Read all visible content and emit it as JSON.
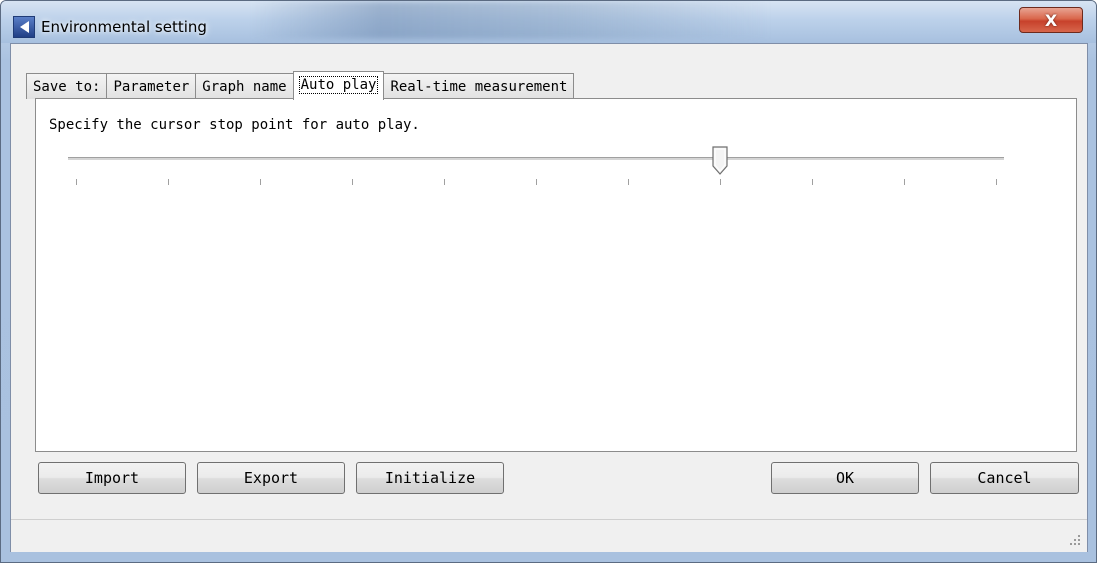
{
  "window": {
    "title": "Environmental setting",
    "close_label": "X"
  },
  "tabs": [
    {
      "label": "Save to:",
      "active": false
    },
    {
      "label": "Parameter",
      "active": false
    },
    {
      "label": "Graph name",
      "active": false
    },
    {
      "label": "Auto play",
      "active": true
    },
    {
      "label": "Real-time measurement",
      "active": false
    }
  ],
  "auto_play": {
    "instruction": "Specify the cursor stop point for auto play.",
    "slider": {
      "min": 0,
      "max": 10,
      "value": 7,
      "tick_count": 11
    }
  },
  "buttons": {
    "import": "Import",
    "export": "Export",
    "initialize": "Initialize",
    "ok": "OK",
    "cancel": "Cancel"
  },
  "colors": {
    "title_bar": "#b9cde6",
    "close_button": "#c7412b",
    "panel_bg": "#ffffff",
    "dialog_bg": "#f0f0f0"
  }
}
